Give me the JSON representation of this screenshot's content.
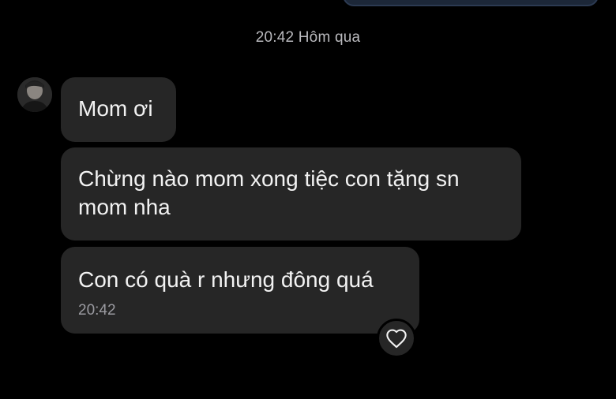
{
  "chat": {
    "header_time": "20:42 Hôm qua",
    "messages": [
      {
        "text": "Mom ơi"
      },
      {
        "text": "Chừng nào mom xong tiệc con tặng sn mom nha"
      },
      {
        "text": "Con có quà r nhưng đông quá",
        "time": "20:42"
      }
    ],
    "icons": {
      "avatar": "contact-avatar",
      "heart": "heart-icon"
    },
    "colors": {
      "background": "#000000",
      "bubble": "#262626",
      "text": "#f2f2f2",
      "muted": "#9a9aa0"
    }
  }
}
